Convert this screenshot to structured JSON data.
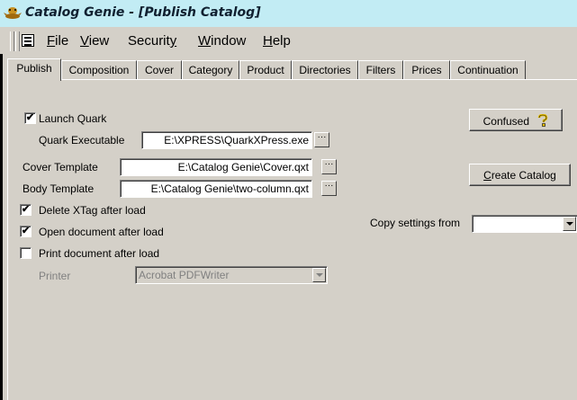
{
  "window": {
    "title": "Catalog Genie - [Publish Catalog]",
    "icon": "genie-lamp-icon"
  },
  "menu": [
    {
      "label": "File",
      "u": "F",
      "rest": "ile"
    },
    {
      "label": "View",
      "u": "V",
      "rest": "iew"
    },
    {
      "label": "Security",
      "pre": "Securit",
      "u": "y",
      "rest": ""
    },
    {
      "label": "Window",
      "u": "W",
      "rest": "indow"
    },
    {
      "label": "Help",
      "u": "H",
      "rest": "elp"
    }
  ],
  "tabs": [
    "Publish",
    "Composition",
    "Cover",
    "Category",
    "Product",
    "Directories",
    "Filters",
    "Prices",
    "Continuation"
  ],
  "active_tab": "Publish",
  "publish": {
    "launch_quark": {
      "label": "Launch Quark",
      "checked": true,
      "mark": "✔"
    },
    "quark_executable": {
      "label": "Quark Executable",
      "value": "E:\\XPRESS\\QuarkXPress.exe"
    },
    "cover_template": {
      "label": "Cover Template",
      "value": "E:\\Catalog Genie\\Cover.qxt"
    },
    "body_template": {
      "label": "Body Template",
      "value": "E:\\Catalog Genie\\two-column.qxt"
    },
    "delete_xtag": {
      "label": "Delete XTag after load",
      "checked": true,
      "mark": "✔"
    },
    "open_document": {
      "label": "Open document after load",
      "checked": true,
      "mark": "✔"
    },
    "print_document": {
      "label": "Print document after load",
      "checked": false,
      "mark": ""
    },
    "printer": {
      "label": "Printer",
      "value": "Acrobat PDFWriter"
    },
    "browse_label": "···",
    "confused_button": {
      "label": "Confused",
      "icon": "question-mark-icon"
    },
    "create_catalog_button": {
      "label": "Create Catalog",
      "u": "C",
      "rest": "reate Catalog"
    },
    "copy_settings": {
      "label": "Copy settings from",
      "value": ""
    }
  },
  "colors": {
    "titlebar": "#c2ecf4",
    "face": "#d4d0c8",
    "question_mark": "#e8c000"
  }
}
